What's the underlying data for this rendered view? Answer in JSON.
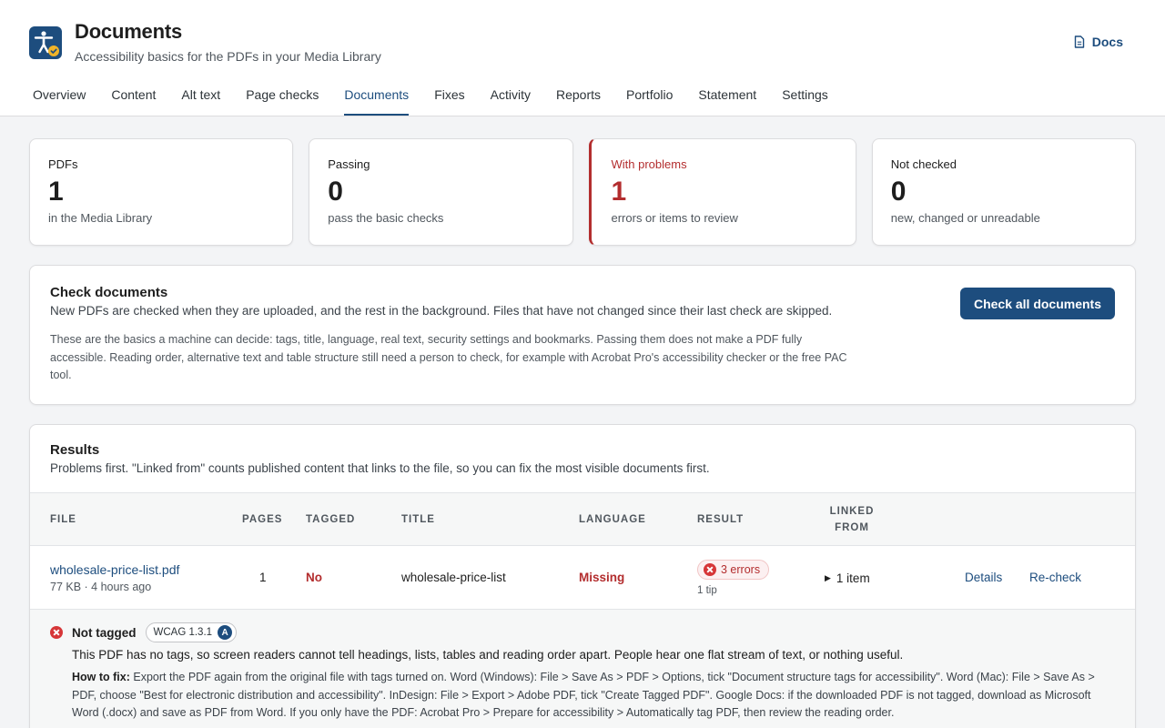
{
  "app": {
    "title": "Documents",
    "subtitle": "Accessibility basics for the PDFs in your Media Library",
    "docs_label": "Docs"
  },
  "tabs": [
    {
      "label": "Overview",
      "active": false
    },
    {
      "label": "Content",
      "active": false
    },
    {
      "label": "Alt text",
      "active": false
    },
    {
      "label": "Page checks",
      "active": false
    },
    {
      "label": "Documents",
      "active": true
    },
    {
      "label": "Fixes",
      "active": false
    },
    {
      "label": "Activity",
      "active": false
    },
    {
      "label": "Reports",
      "active": false
    },
    {
      "label": "Portfolio",
      "active": false
    },
    {
      "label": "Statement",
      "active": false
    },
    {
      "label": "Settings",
      "active": false
    }
  ],
  "stats": [
    {
      "label": "PDFs",
      "value": "1",
      "caption": "in the Media Library"
    },
    {
      "label": "Passing",
      "value": "0",
      "caption": "pass the basic checks"
    },
    {
      "label": "With problems",
      "value": "1",
      "caption": "errors or items to review"
    },
    {
      "label": "Not checked",
      "value": "0",
      "caption": "new, changed or unreadable"
    }
  ],
  "check": {
    "title": "Check documents",
    "description": "New PDFs are checked when they are uploaded, and the rest in the background. Files that have not changed since their last check are skipped.",
    "note": "These are the basics a machine can decide: tags, title, language, real text, security settings and bookmarks. Passing them does not make a PDF fully accessible. Reading order, alternative text and table structure still need a person to check, for example with Acrobat Pro's accessibility checker or the free PAC tool.",
    "button": "Check all documents"
  },
  "results": {
    "title": "Results",
    "description": "Problems first. \"Linked from\" counts published content that links to the file, so you can fix the most visible documents first.",
    "columns": [
      "File",
      "Pages",
      "Tagged",
      "Title",
      "Language",
      "Result",
      "Linked from"
    ],
    "row": {
      "file": "wholesale-price-list.pdf",
      "meta": "77 KB · 4 hours ago",
      "pages": "1",
      "tagged": "No",
      "title": "wholesale-price-list",
      "language": "Missing",
      "result": "3 errors",
      "tip": "1 tip",
      "linked": "1 item",
      "details": "Details",
      "recheck": "Re-check"
    },
    "issue": {
      "title": "Not tagged",
      "wcag": "WCAG 1.3.1",
      "level": "A",
      "description": "This PDF has no tags, so screen readers cannot tell headings, lists, tables and reading order apart. People hear one flat stream of text, or nothing useful.",
      "fix_label": "How to fix:",
      "fix_text": "Export the PDF again from the original file with tags turned on. Word (Windows): File > Save As > PDF > Options, tick \"Document structure tags for accessibility\". Word (Mac): File > Save As > PDF, choose \"Best for electronic distribution and accessibility\". InDesign: File > Export > Adobe PDF, tick \"Create Tagged PDF\". Google Docs: if the downloaded PDF is not tagged, download as Microsoft Word (.docx) and save as PDF from Word. If you only have the PDF: Acrobat Pro > Prepare for accessibility > Automatically tag PDF, then review the reading order."
    }
  },
  "colors": {
    "accent": "#1d4d7e",
    "error": "#b32d2e",
    "background": "#f3f4f6"
  }
}
